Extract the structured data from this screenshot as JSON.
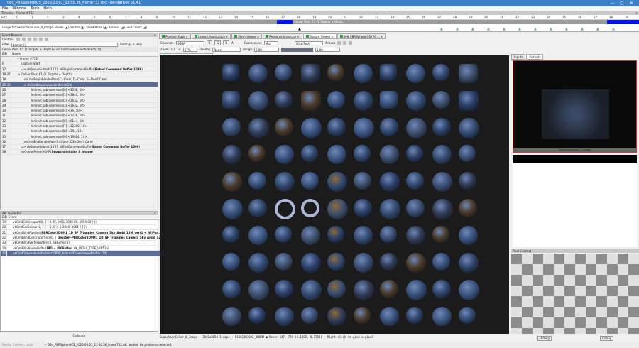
{
  "window": {
    "title": "06d_PBRSphereICS_2026.03.01_13.50.36_frame732.rdc - RenderDoc v1.41",
    "controls": [
      "—",
      "▢",
      "✕"
    ]
  },
  "menu": [
    "File",
    "Window",
    "Tools",
    "Help"
  ],
  "timeline": {
    "title": "Timeline - Frame #732",
    "eid_label": "EID:",
    "ticks": [
      "0",
      "1",
      "2",
      "3",
      "4",
      "5",
      "6",
      "7",
      "8",
      "9",
      "10",
      "11",
      "12",
      "13",
      "14",
      "15",
      "16",
      "17",
      "18",
      "19",
      "20",
      "21",
      "22",
      "23",
      "24",
      "25",
      "26",
      "27",
      "28",
      "29",
      "30",
      "31",
      "32",
      "33",
      "34",
      "35",
      "36",
      "37",
      "38",
      "39"
    ],
    "pass_label": "Colour Pass #1 (1 Targets + Depth)",
    "usage": "Usage for SwapchainColor_0_Image: Reads (▲), Writes (▲), Read/Write (▲) Barriers (▲), and Clears (▲)",
    "colors": {
      "pass": "#0016e6",
      "bar": "#9a9a9a"
    }
  },
  "event_browser": {
    "title": "Event Browser",
    "controls_label": "Controls",
    "filter_label": "Filter",
    "filter_value": "$action()",
    "settings_label": "Settings & Help",
    "breadcrumb": "Colour Pass #1 (1 Targets + Depth) ▸ vkCmdDrawIndexedIndirect(10)",
    "columns": [
      "EID",
      "Name"
    ],
    "rows": [
      {
        "eid": "",
        "name": "− Frame #732"
      },
      {
        "eid": "0",
        "name": "Capture Start"
      },
      {
        "eid": "17",
        "name": "=> vkQueueSubmit(1)[0]: vkBeginCommandBuffer(",
        "bold": "Baked Command Buffer 1099",
        "tail": ")"
      },
      {
        "eid": "18-37",
        "name": "∨ Colour Pass #1 (1 Targets + Depth)"
      },
      {
        "eid": "18",
        "name": "vkCmdBeginRenderPass(C=Clear, D=Clear, S=Don't Care)"
      },
      {
        "eid": "25-35",
        "name": "∨ vkCmdDrawIndexedIndirect(10)",
        "selected": true
      },
      {
        "eid": "26",
        "name": "Indirect sub-command[0]:<1536, 10>"
      },
      {
        "eid": "27",
        "name": "Indirect sub-command[1]:<3840, 10>"
      },
      {
        "eid": "28",
        "name": "Indirect sub-command[2]:<1632, 10>"
      },
      {
        "eid": "29",
        "name": "Indirect sub-command[3]:<1632, 10>"
      },
      {
        "eid": "30",
        "name": "Indirect sub-command[4]:<36, 10>"
      },
      {
        "eid": "31",
        "name": "Indirect sub-command[5]:<1728, 10>"
      },
      {
        "eid": "32",
        "name": "Indirect sub-command[6]:<6144, 10>"
      },
      {
        "eid": "33",
        "name": "Indirect sub-command[7]:<12288, 10>"
      },
      {
        "eid": "34",
        "name": "Indirect sub-command[8]:<384, 10>"
      },
      {
        "eid": "35",
        "name": "Indirect sub-command[9]:<13824, 10>"
      },
      {
        "eid": "36",
        "name": "vkCmdEndRenderPass(C=Store, DS=Don't Care)"
      },
      {
        "eid": "37",
        "name": "=> vkQueueSubmit(1)[0]: vkEndCommandBuffer(",
        "bold": "Baked Command Buffer 1099",
        "tail": ")"
      },
      {
        "eid": "38",
        "name": "vkQueuePresentKHR(",
        "bold": "SwapchainColor_0_Image",
        "tail": ")"
      }
    ]
  },
  "api_inspector": {
    "title": "API Inspector",
    "columns": [
      "EID",
      "Event"
    ],
    "rows": [
      {
        "eid": "19",
        "name": "vkCmdSetViewport(0, { [ 0.00, 0.00, 3840.00, 2054.00 ] })"
      },
      {
        "eid": "20",
        "name": "vkCmdSetScissor(0, { [ { 0, 0 }, { 3840, 3054 } ] })"
      },
      {
        "eid": "21",
        "name": "vkCmdBindPipeline(",
        "bold": "PBRColor3D9M1_1D_SF_Triangles_Camera_Sky_Ambl_12M_vert1 + /WiPip...",
        "tail": ""
      },
      {
        "eid": "22",
        "name": "vkCmdBindDescriptorSets(0, { ",
        "bold": "DescSet-PBRColor3D9M1_1D_SF_Triangles_Camera_Sky_Ambl_12M",
        "tail": ""
      },
      {
        "eid": "23",
        "name": "vkCmdBindVertexBuffers(0, VkBuffer[3])"
      },
      {
        "eid": "24",
        "name": "vkCmdBindIndexBuffer(",
        "bold": "IBO = /4KBuffer",
        "tail": ", VK_INDEX_TYPE_UINT16)"
      },
      {
        "eid": "25",
        "name": "vkCmdDrawIndexedIndirect(SPBR_IndirectDrawIndexedBuffer, 10)",
        "selected": true
      }
    ],
    "callstack_label": "Callstack"
  },
  "tabs": [
    "Pipeline State",
    "Launch Application",
    "Mesh Viewer",
    "Resource Inspector",
    "Texture Viewer",
    "06d_PBRSphereICS (R0 ..."
  ],
  "active_tab": 4,
  "texture_toolbar": {
    "channels_label": "Channels",
    "channels_value": "RGBA",
    "channel_buttons": [
      "R",
      "G",
      "B",
      "A"
    ],
    "subresource_label": "Subresource",
    "subresource_value": "Mip",
    "slice_value": "Slice/Face",
    "actions_label": "Actions",
    "zoom_label": "Zoom",
    "zoom_fit": "1:1",
    "fit_label": "Fit",
    "zoom_value": "87%",
    "overlay_label": "Overlay",
    "overlay_value": "None",
    "range_label": "Range",
    "range_min": "0.00",
    "range_max": "1.00",
    "viewer_tab": "Cur Output 0 - SwapchainCol..."
  },
  "texture_status": "SwapchainColor_0_Image - 3840x2054 1 mips - R10G10B10A2_UNORM  ■  Never    647,  774 (0.1685, 0.3768) - Right click to pick a pixel",
  "right_panel": {
    "tabs": [
      "Inputs",
      "Outputs"
    ],
    "active_tab": 1,
    "thumb_label": "SwapchainColor_0_Image",
    "thumb_index": "0",
    "pixel_context_title": "Pixel Context",
    "history_button": "History",
    "debug_button": "Debug",
    "highlight_color": "#e03030"
  },
  "statusbar": {
    "replay_label": "Replay Context: Local",
    "message": "06d_PBRSphereICS_2026.03.01_13.50.36_frame732.rdc loaded. No problems detected."
  }
}
